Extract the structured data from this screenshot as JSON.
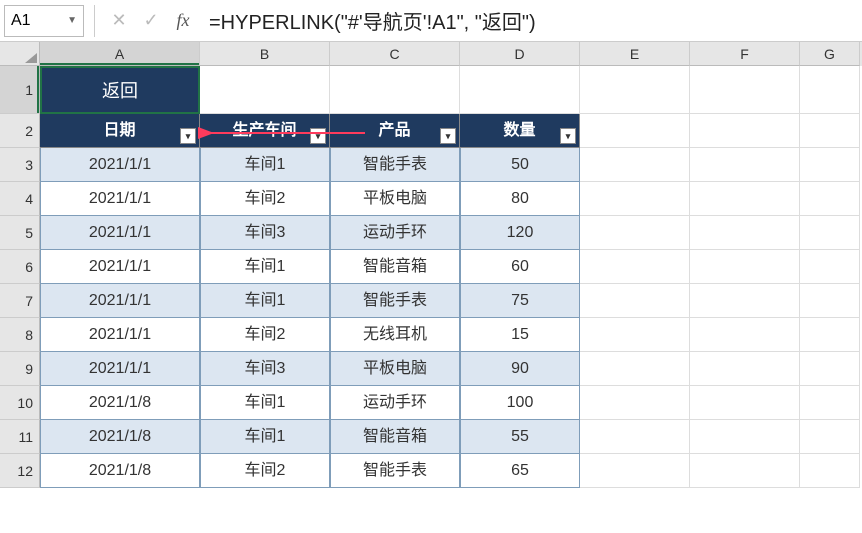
{
  "nameBox": "A1",
  "formula": "=HYPERLINK(\"#'导航页'!A1\", \"返回\")",
  "columns": [
    "A",
    "B",
    "C",
    "D",
    "E",
    "F",
    "G"
  ],
  "backButton": "返回",
  "headers": [
    "日期",
    "生产车间",
    "产品",
    "数量"
  ],
  "rows": [
    {
      "n": 3,
      "d": [
        "2021/1/1",
        "车间1",
        "智能手表",
        "50"
      ],
      "odd": true
    },
    {
      "n": 4,
      "d": [
        "2021/1/1",
        "车间2",
        "平板电脑",
        "80"
      ],
      "odd": false
    },
    {
      "n": 5,
      "d": [
        "2021/1/1",
        "车间3",
        "运动手环",
        "120"
      ],
      "odd": true
    },
    {
      "n": 6,
      "d": [
        "2021/1/1",
        "车间1",
        "智能音箱",
        "60"
      ],
      "odd": false
    },
    {
      "n": 7,
      "d": [
        "2021/1/1",
        "车间1",
        "智能手表",
        "75"
      ],
      "odd": true
    },
    {
      "n": 8,
      "d": [
        "2021/1/1",
        "车间2",
        "无线耳机",
        "15"
      ],
      "odd": false
    },
    {
      "n": 9,
      "d": [
        "2021/1/1",
        "车间3",
        "平板电脑",
        "90"
      ],
      "odd": true
    },
    {
      "n": 10,
      "d": [
        "2021/1/8",
        "车间1",
        "运动手环",
        "100"
      ],
      "odd": false
    },
    {
      "n": 11,
      "d": [
        "2021/1/8",
        "车间1",
        "智能音箱",
        "55"
      ],
      "odd": true
    },
    {
      "n": 12,
      "d": [
        "2021/1/8",
        "车间2",
        "智能手表",
        "65"
      ],
      "odd": false
    }
  ],
  "chart_data": {
    "type": "table",
    "title": "",
    "columns": [
      "日期",
      "生产车间",
      "产品",
      "数量"
    ],
    "rows": [
      [
        "2021/1/1",
        "车间1",
        "智能手表",
        50
      ],
      [
        "2021/1/1",
        "车间2",
        "平板电脑",
        80
      ],
      [
        "2021/1/1",
        "车间3",
        "运动手环",
        120
      ],
      [
        "2021/1/1",
        "车间1",
        "智能音箱",
        60
      ],
      [
        "2021/1/1",
        "车间1",
        "智能手表",
        75
      ],
      [
        "2021/1/1",
        "车间2",
        "无线耳机",
        15
      ],
      [
        "2021/1/1",
        "车间3",
        "平板电脑",
        90
      ],
      [
        "2021/1/8",
        "车间1",
        "运动手环",
        100
      ],
      [
        "2021/1/8",
        "车间1",
        "智能音箱",
        55
      ],
      [
        "2021/1/8",
        "车间2",
        "智能手表",
        65
      ]
    ]
  }
}
